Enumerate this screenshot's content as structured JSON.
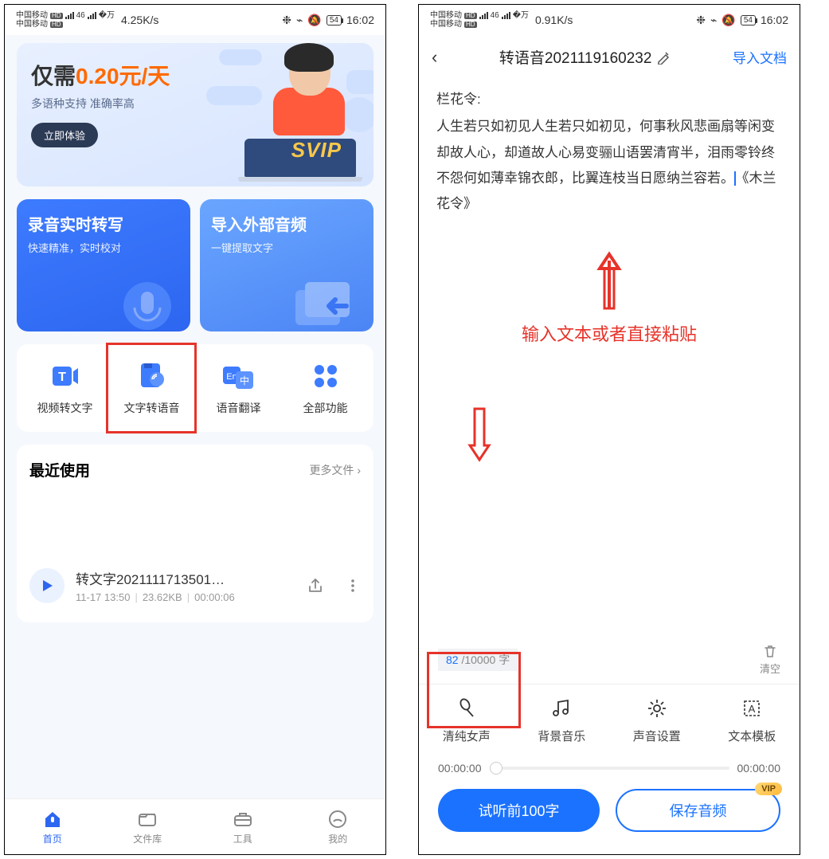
{
  "status_left": {
    "carrier": "中国移动",
    "hd": "HD",
    "net": "46",
    "speed_a": "4.25K/s",
    "speed_b": "0.91K/s",
    "battery": "54",
    "time": "16:02"
  },
  "left": {
    "promo": {
      "prefix": "仅需",
      "price": "0.20元/天",
      "sub": "多语种支持 准确率高",
      "btn": "立即体验",
      "svip": "SVIP"
    },
    "card_a": {
      "title": "录音实时转写",
      "sub": "快速精准，实时校对"
    },
    "card_b": {
      "title": "导入外部音频",
      "sub": "一键提取文字"
    },
    "funcs": [
      "视频转文字",
      "文字转语音",
      "语音翻译",
      "全部功能"
    ],
    "recent": {
      "title": "最近使用",
      "more": "更多文件",
      "chev": "›"
    },
    "file": {
      "name": "转文字2021111713501…",
      "date": "11-17 13:50",
      "size": "23.62KB",
      "dur": "00:00:06"
    },
    "tabs": [
      "首页",
      "文件库",
      "工具",
      "我的"
    ]
  },
  "right": {
    "title": "转语音2021119160232",
    "import": "导入文档",
    "poem_title": "栏花令:",
    "poem_body": "人生若只如初见人生若只如初见，何事秋风悲画扇等闲变却故人心，却道故人心易变骊山语罢清宵半，泪雨零铃终不怨何如薄幸锦衣郎，比翼连枝当日愿纳兰容若。",
    "poem_tail": "《木兰花令》",
    "hint": "输入文本或者直接粘贴",
    "count_cur": "82",
    "count_sep": "/",
    "count_max": "10000",
    "count_unit": "字",
    "clear": "清空",
    "tools": [
      "清纯女声",
      "背景音乐",
      "声音设置",
      "文本模板"
    ],
    "time_start": "00:00:00",
    "time_end": "00:00:00",
    "btn_preview": "试听前100字",
    "btn_save": "保存音频",
    "vip": "VIP"
  }
}
